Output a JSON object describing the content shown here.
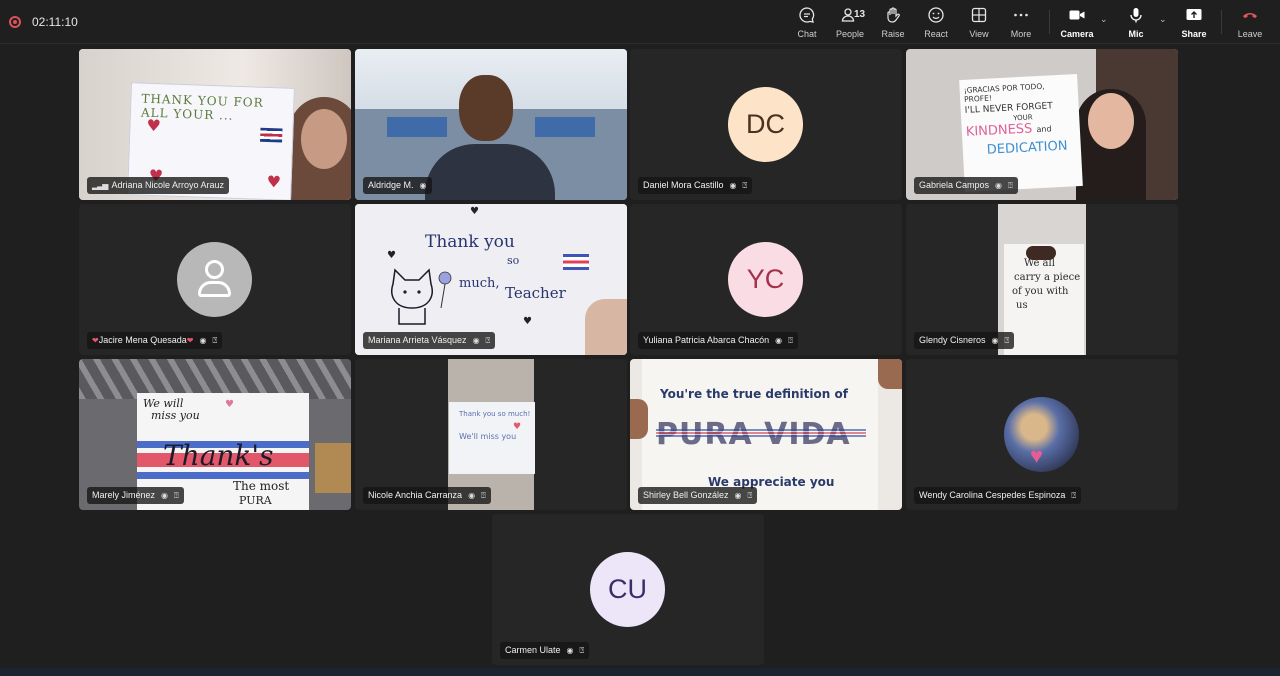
{
  "timer": "02:11:10",
  "toolbar": {
    "chat": "Chat",
    "people": "People",
    "people_count": "13",
    "raise": "Raise",
    "react": "React",
    "view": "View",
    "more": "More",
    "camera": "Camera",
    "mic": "Mic",
    "share": "Share",
    "leave": "Leave"
  },
  "participants": [
    {
      "name": "Adriana Nicole Arroyo Arauz"
    },
    {
      "name": "Aldridge M."
    },
    {
      "name": "Daniel Mora Castillo",
      "initials": "DC",
      "color": "#fde3c8"
    },
    {
      "name": "Gabriela Campos"
    },
    {
      "name": "Jacire Mena Quesada"
    },
    {
      "name": "Mariana Arrieta Vásquez"
    },
    {
      "name": "Yuliana Patricia Abarca Chacón",
      "initials": "YC",
      "color": "#fadde4"
    },
    {
      "name": "Glendy Cisneros"
    },
    {
      "name": "Marely Jiménez"
    },
    {
      "name": "Nicole Anchia Carranza"
    },
    {
      "name": "Shirley Bell González"
    },
    {
      "name": "Wendy Carolina Cespedes Espinoza"
    },
    {
      "name": "Carmen Ulate",
      "initials": "CU",
      "color": "#ece6f8"
    }
  ],
  "signs": {
    "adriana": "THANK YOU FOR ALL YOUR ...",
    "gabriela_1": "¡GRACIAS POR TODO, PROFE!",
    "gabriela_2": "I'LL NEVER FORGET",
    "gabriela_3": "YOUR",
    "gabriela_4": "KINDNESS",
    "gabriela_5": "and",
    "gabriela_6": "DEDICATION",
    "mariana_1": "Thank you",
    "mariana_2": "so",
    "mariana_3": "much,",
    "mariana_4": "Teacher",
    "glendy_1": "We all",
    "glendy_2": "carry a piece",
    "glendy_3": "of you with",
    "glendy_4": "us",
    "marely_1": "We will",
    "marely_2": "miss you",
    "marely_3": "Thank's",
    "marely_4": "The most",
    "marely_5": "PURA",
    "nicole_1": "Thank you so much!",
    "nicole_2": "We'll miss you",
    "shirley_1": "You're the true definition of",
    "shirley_2": "PURA VIDA",
    "shirley_3": "We appreciate you"
  }
}
